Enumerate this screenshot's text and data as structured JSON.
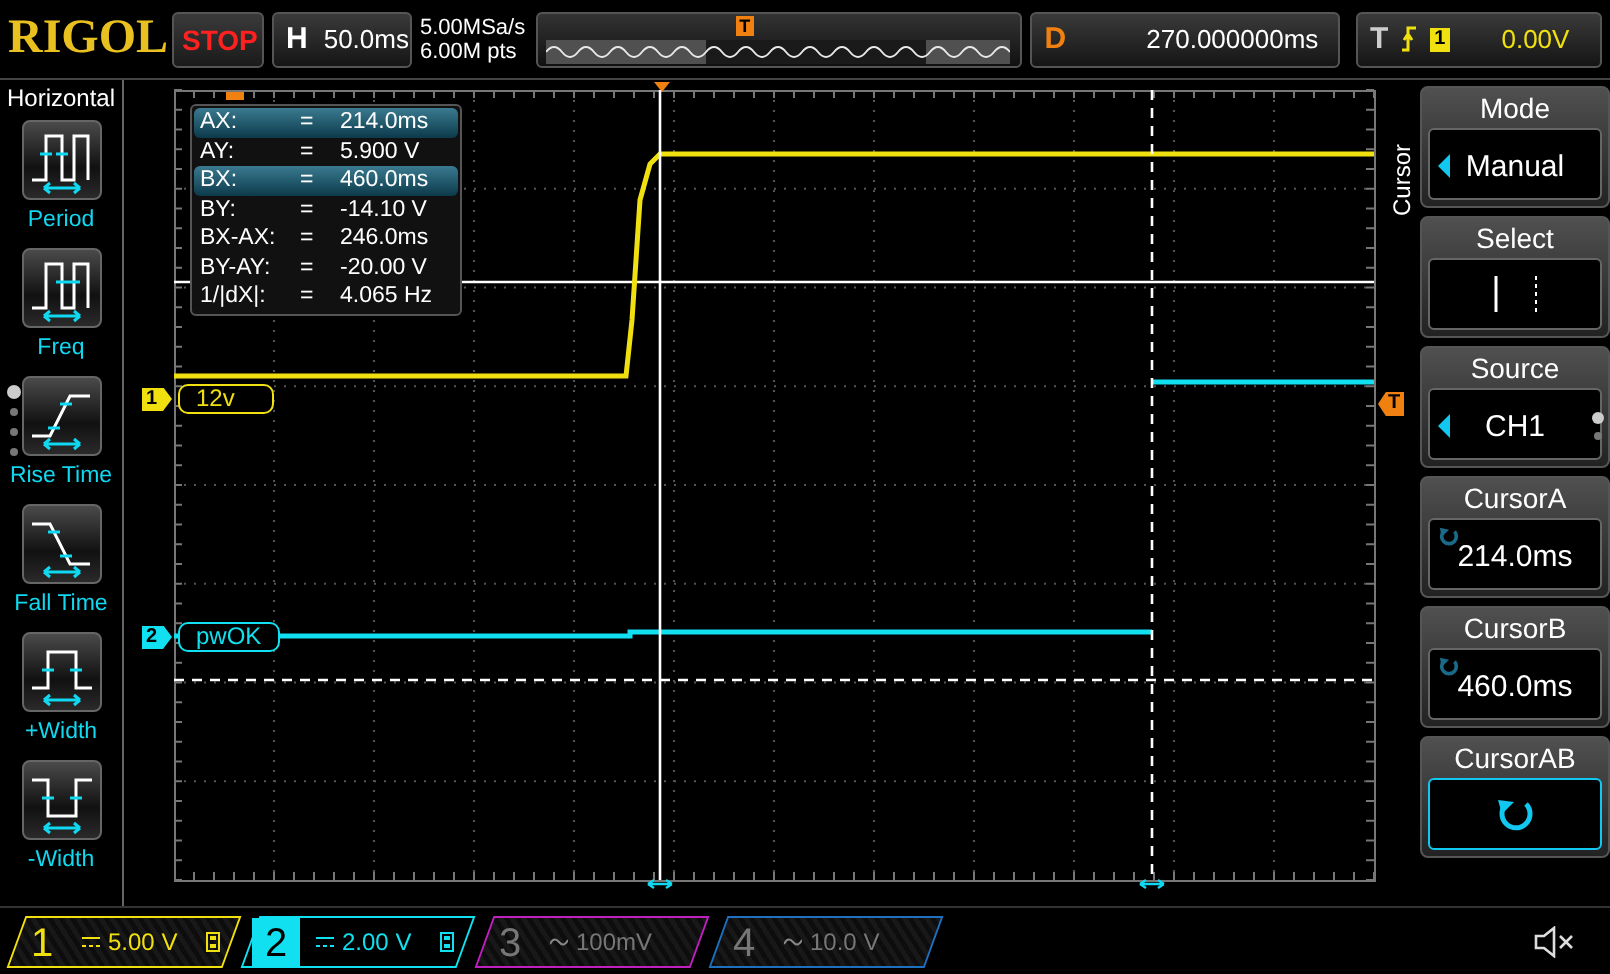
{
  "header": {
    "brand": "RIGOL",
    "run_state": "STOP",
    "timebase": {
      "label": "H",
      "value": "50.0ms"
    },
    "sample_rate": "5.00MSa/s",
    "memory_depth": "6.00M pts",
    "overview_marker": "T",
    "delay": {
      "label": "D",
      "value": "270.000000ms"
    },
    "trigger": {
      "label": "T",
      "source": "1",
      "level": "0.00V"
    }
  },
  "left_menu": {
    "title": "Horizontal",
    "items": [
      {
        "label": "Period",
        "kind": "period"
      },
      {
        "label": "Freq",
        "kind": "freq"
      },
      {
        "label": "Rise Time",
        "kind": "rise"
      },
      {
        "label": "Fall Time",
        "kind": "fall"
      },
      {
        "label": "+Width",
        "kind": "pwidth"
      },
      {
        "label": "-Width",
        "kind": "nwidth"
      }
    ]
  },
  "measurements": [
    {
      "label": "AX:",
      "eq": "=",
      "value": "214.0ms",
      "selected": true
    },
    {
      "label": "AY:",
      "eq": "=",
      "value": "5.900 V",
      "selected": false
    },
    {
      "label": "BX:",
      "eq": "=",
      "value": "460.0ms",
      "selected": true
    },
    {
      "label": "BY:",
      "eq": "=",
      "value": "-14.10 V",
      "selected": false
    },
    {
      "label": "BX-AX:",
      "eq": "=",
      "value": "246.0ms",
      "selected": false
    },
    {
      "label": "BY-AY:",
      "eq": "=",
      "value": "-20.00 V",
      "selected": false
    },
    {
      "label": "1/|dX|:",
      "eq": "=",
      "value": "4.065 Hz",
      "selected": false
    }
  ],
  "channel_labels": [
    {
      "marker": "1",
      "text": "12v",
      "color": "#f0e010"
    },
    {
      "marker": "2",
      "text": "pwOK",
      "color": "#10e0f0"
    }
  ],
  "trigger_marker": "T",
  "right_menu": {
    "side_label": "Cursor",
    "items": [
      {
        "title": "Mode",
        "value": "Manual",
        "kind": "select",
        "selected": false
      },
      {
        "title": "Select",
        "kind": "ab_select",
        "selected": false
      },
      {
        "title": "Source",
        "value": "CH1",
        "kind": "select",
        "selected": false
      },
      {
        "title": "CursorA",
        "value": "214.0ms",
        "kind": "knob",
        "selected": false
      },
      {
        "title": "CursorB",
        "value": "460.0ms",
        "kind": "knob",
        "selected": false
      },
      {
        "title": "CursorAB",
        "kind": "knob_only",
        "selected": true
      }
    ]
  },
  "channels": [
    {
      "number": "1",
      "kind": "dc",
      "scale": "5.00 V",
      "on": true,
      "selected": false,
      "color": "#f0e010"
    },
    {
      "number": "2",
      "kind": "dc",
      "scale": "2.00 V",
      "on": true,
      "selected": true,
      "color": "#10e0f0"
    },
    {
      "number": "3",
      "kind": "ac",
      "scale": "100mV",
      "on": false,
      "selected": false,
      "color": "#c020c0"
    },
    {
      "number": "4",
      "kind": "ac",
      "scale": "10.0 V",
      "on": false,
      "selected": false,
      "color": "#2070c0"
    }
  ],
  "sound_muted": true
}
